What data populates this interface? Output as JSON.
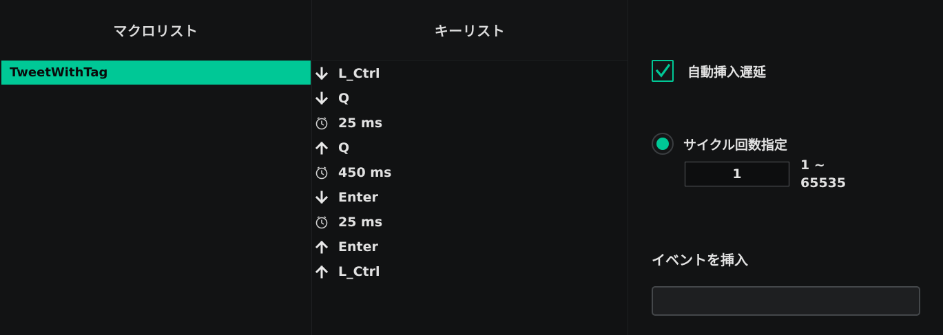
{
  "macro_panel": {
    "header": "マクロリスト",
    "items": [
      {
        "label": "TweetWithTag",
        "selected": true
      }
    ]
  },
  "key_panel": {
    "header": "キーリスト",
    "items": [
      {
        "icon": "arrow-down-icon",
        "label": "L_Ctrl"
      },
      {
        "icon": "arrow-down-icon",
        "label": "Q"
      },
      {
        "icon": "clock-icon",
        "label": "25 ms"
      },
      {
        "icon": "arrow-up-icon",
        "label": "Q"
      },
      {
        "icon": "clock-icon",
        "label": "450 ms"
      },
      {
        "icon": "arrow-down-icon",
        "label": "Enter"
      },
      {
        "icon": "clock-icon",
        "label": "25 ms"
      },
      {
        "icon": "arrow-up-icon",
        "label": "Enter"
      },
      {
        "icon": "arrow-up-icon",
        "label": "L_Ctrl"
      }
    ]
  },
  "settings": {
    "auto_delay": {
      "label": "自動挿入遅延",
      "checked": true
    },
    "cycle": {
      "label": "サイクル回数指定",
      "selected": true,
      "value": "1",
      "range_line1": "1 ~",
      "range_line2": "65535"
    },
    "insert_event": {
      "label": "イベントを挿入",
      "value": ""
    }
  },
  "colors": {
    "accent": "#00c896",
    "background": "#111213",
    "text": "#e2e2e2"
  }
}
